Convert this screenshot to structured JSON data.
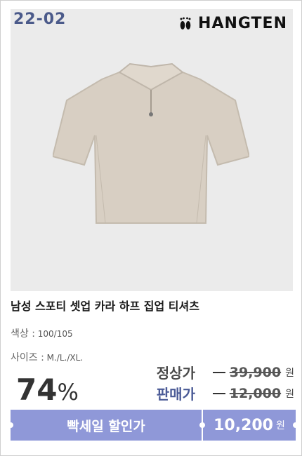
{
  "product": {
    "code": "22-02",
    "brand": "HANGTEN",
    "title": "남성 스포티 셋업 카라 하프 집업 티셔츠",
    "color_label": "색상 :",
    "color_value": "100/105",
    "size_label": "사이즈 :",
    "size_value": "M./L./XL.",
    "discount_value": "74",
    "discount_unit": "%"
  },
  "prices": {
    "regular_label": "정상가",
    "regular_value": "39,900",
    "sale_label": "판매가",
    "sale_value": "12,000",
    "currency": "원"
  },
  "promo": {
    "label": "빡세일 할인가",
    "value": "10,200",
    "currency": "원"
  },
  "colors": {
    "accent": "#8f98d8",
    "code_text": "#4b5a8a",
    "sale_label": "#4a5a96",
    "photo_bg": "#ebebeb",
    "shirt": "#d8cfc3"
  }
}
